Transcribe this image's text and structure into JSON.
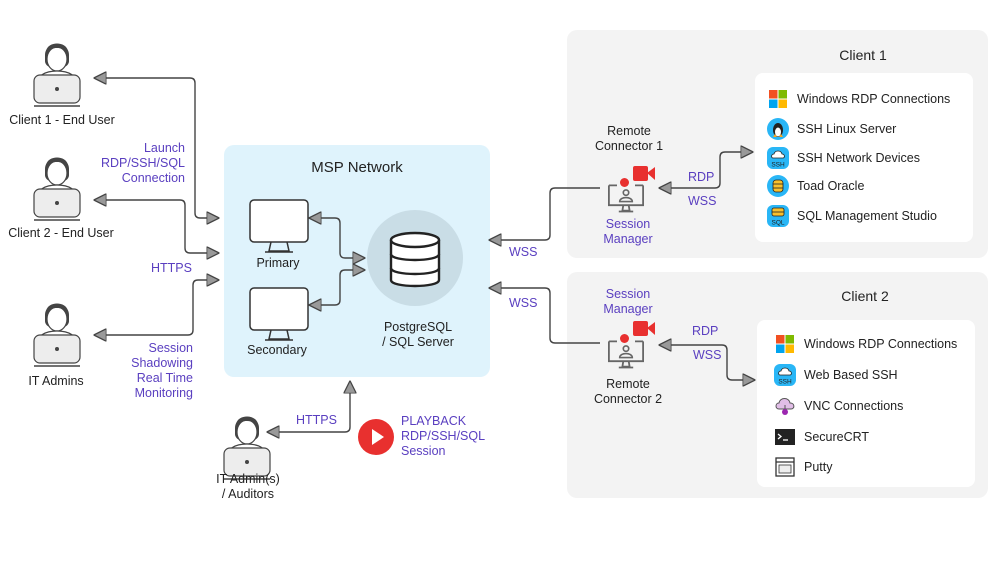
{
  "users": [
    {
      "label": "Client 1 - End User"
    },
    {
      "label": "Client 2 - End User"
    },
    {
      "label": "IT Admins"
    }
  ],
  "edge_labels": {
    "launch": [
      "Launch",
      "RDP/SSH/SQL",
      "Connection"
    ],
    "https_left": "HTTPS",
    "shadowing": [
      "Session",
      "Shadowing",
      "Real Time",
      "Monitoring"
    ],
    "https_bottom": "HTTPS",
    "wss1": "WSS",
    "wss2": "WSS",
    "rdp1": "RDP",
    "wss1b": "WSS",
    "rdp2": "RDP",
    "wss2b": "WSS"
  },
  "msp": {
    "title": "MSP Network",
    "primary": "Primary",
    "secondary": "Secondary",
    "db": [
      "PostgreSQL",
      "/ SQL Server"
    ]
  },
  "auditors": {
    "label": [
      "IT Admin(s)",
      "/ Auditors"
    ]
  },
  "playback": [
    "PLAYBACK",
    "RDP/SSH/SQL",
    "Session"
  ],
  "connector1": {
    "title": [
      "Remote",
      "Connector 1"
    ],
    "session_manager": [
      "Session",
      "Manager"
    ]
  },
  "connector2": {
    "title": [
      "Remote",
      "Connector 2"
    ],
    "session_manager": [
      "Session",
      "Manager"
    ]
  },
  "client1": {
    "title": "Client 1",
    "items": [
      {
        "label": "Windows RDP Connections",
        "icon": "windows-icon"
      },
      {
        "label": "SSH Linux Server",
        "icon": "linux-icon"
      },
      {
        "label": "SSH Network Devices",
        "icon": "ssh-cloud-icon"
      },
      {
        "label": "Toad Oracle",
        "icon": "database-icon"
      },
      {
        "label": "SQL Management Studio",
        "icon": "sql-icon"
      }
    ]
  },
  "client2": {
    "title": "Client 2",
    "items": [
      {
        "label": "Windows RDP Connections",
        "icon": "windows-icon"
      },
      {
        "label": "Web Based SSH",
        "icon": "ssh-cloud-icon"
      },
      {
        "label": "VNC Connections",
        "icon": "vnc-icon"
      },
      {
        "label": "SecureCRT",
        "icon": "terminal-icon"
      },
      {
        "label": "Putty",
        "icon": "putty-icon"
      }
    ]
  },
  "colors": {
    "accent": "#5a3fc0",
    "msp_bg": "#dff3fc",
    "panel_bg": "#f3f3f3",
    "red": "#e8302f",
    "line": "#555555"
  }
}
